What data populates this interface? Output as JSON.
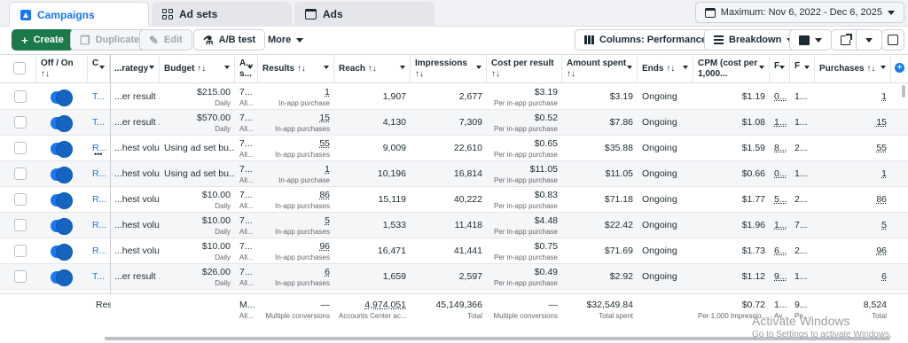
{
  "tabs": [
    {
      "label": "Campaigns",
      "icon": "campaign-icon"
    },
    {
      "label": "Ad sets",
      "icon": "grid-icon"
    },
    {
      "label": "Ads",
      "icon": "window-icon"
    }
  ],
  "date_range": "Maximum: Nov 6, 2022 - Dec 6, 2025",
  "toolbar": {
    "create": "Create",
    "duplicate": "Duplicate",
    "edit": "Edit",
    "ab_test": "A/B test",
    "more": "More",
    "columns": "Columns: Performance",
    "breakdown": "Breakdown"
  },
  "headers": {
    "off_on": "Off / On",
    "off_on_sort": "↑↓",
    "name": "C",
    "strategy": "...rategy",
    "budget": "Budget ↑↓",
    "attribution": "A...",
    "attribution2": "s...",
    "results": "Results ↑↓",
    "reach": "Reach ↑↓",
    "impressions": "Impressions",
    "impressions_sort": "↑↓",
    "cpr": "Cost per result",
    "cpr_sort": "↑↓",
    "amount_spent": "Amount spent",
    "amount_spent_sort": "↑↓",
    "ends": "Ends ↑↓",
    "cpm": "CPM (cost per",
    "cpm2": "1,000...",
    "col_f": "F",
    "col_i": "F",
    "purchases": "Purchases ↑↓"
  },
  "rows": [
    {
      "name": "T...",
      "strategy": "...er result ...",
      "budget": "$215.00",
      "budget_sub": "Daily",
      "attr": "7...",
      "attr_sub": "All...",
      "results": "1",
      "results_sub": "In-app purchase",
      "reach": "1,907",
      "impressions": "2,677",
      "cpr": "$3.19",
      "cpr_sub": "Per in-app purchase",
      "spent": "$3.19",
      "ends": "Ongoing",
      "cpm": "$1.19",
      "f": "0...",
      "i": "1...",
      "purchases": "1",
      "dots": false
    },
    {
      "name": "T...",
      "strategy": "...er result ...",
      "budget": "$570.00",
      "budget_sub": "Daily",
      "attr": "7...",
      "attr_sub": "All...",
      "results": "15",
      "results_sub": "In-app purchases",
      "reach": "4,130",
      "impressions": "7,309",
      "cpr": "$0.52",
      "cpr_sub": "Per in-app purchase",
      "spent": "$7.86",
      "ends": "Ongoing",
      "cpm": "$1.08",
      "f": "1...",
      "i": "1...",
      "purchases": "15",
      "dots": false
    },
    {
      "name": "R...",
      "strategy": "...hest volume",
      "budget": "Using ad set bu...",
      "budget_sub": "",
      "attr": "7...",
      "attr_sub": "All...",
      "results": "55",
      "results_sub": "In-app purchases",
      "reach": "9,009",
      "impressions": "22,610",
      "cpr": "$0.65",
      "cpr_sub": "Per in-app purchase",
      "spent": "$35.88",
      "ends": "Ongoing",
      "cpm": "$1.59",
      "f": "8...",
      "i": "2...",
      "purchases": "55",
      "dots": true
    },
    {
      "name": "R...",
      "strategy": "...hest volume",
      "budget": "Using ad set bu...",
      "budget_sub": "",
      "attr": "7...",
      "attr_sub": "All...",
      "results": "1",
      "results_sub": "In-app purchase",
      "reach": "10,196",
      "impressions": "16,814",
      "cpr": "$11.05",
      "cpr_sub": "Per in-app purchase",
      "spent": "$11.05",
      "ends": "Ongoing",
      "cpm": "$0.66",
      "f": "0...",
      "i": "1...",
      "purchases": "1",
      "dots": false
    },
    {
      "name": "R...",
      "strategy": "...hest volume",
      "budget": "$10.00",
      "budget_sub": "Daily",
      "attr": "7...",
      "attr_sub": "All...",
      "results": "86",
      "results_sub": "In-app purchases",
      "reach": "15,119",
      "impressions": "40,222",
      "cpr": "$0.83",
      "cpr_sub": "Per in-app purchase",
      "spent": "$71.18",
      "ends": "Ongoing",
      "cpm": "$1.77",
      "f": "5...",
      "i": "2...",
      "purchases": "86",
      "dots": false
    },
    {
      "name": "R...",
      "strategy": "...hest volume",
      "budget": "$10.00",
      "budget_sub": "Daily",
      "attr": "7...",
      "attr_sub": "All...",
      "results": "5",
      "results_sub": "In-app purchases",
      "reach": "1,533",
      "impressions": "11,418",
      "cpr": "$4.48",
      "cpr_sub": "Per in-app purchase",
      "spent": "$22.42",
      "ends": "Ongoing",
      "cpm": "$1.96",
      "f": "1...",
      "i": "7...",
      "purchases": "5",
      "dots": false
    },
    {
      "name": "R...",
      "strategy": "...hest volume",
      "budget": "$10.00",
      "budget_sub": "Daily",
      "attr": "7...",
      "attr_sub": "All...",
      "results": "96",
      "results_sub": "In-app purchases",
      "reach": "16,471",
      "impressions": "41,441",
      "cpr": "$0.75",
      "cpr_sub": "Per in-app purchase",
      "spent": "$71.69",
      "ends": "Ongoing",
      "cpm": "$1.73",
      "f": "6...",
      "i": "2...",
      "purchases": "96",
      "dots": false
    },
    {
      "name": "T...",
      "strategy": "...er result ...",
      "budget": "$26.00",
      "budget_sub": "Daily",
      "attr": "7...",
      "attr_sub": "All...",
      "results": "6",
      "results_sub": "In-app purchases",
      "reach": "1,659",
      "impressions": "2,597",
      "cpr": "$0.49",
      "cpr_sub": "Per in-app purchase",
      "spent": "$2.92",
      "ends": "Ongoing",
      "cpm": "$1.12",
      "f": "9...",
      "i": "1...",
      "purchases": "6",
      "dots": false
    }
  ],
  "footer": {
    "label": "Res",
    "attr": "M...",
    "attr_sub": "All...",
    "results": "—",
    "results_sub": "Multiple conversions",
    "reach": "4,974,051",
    "reach_sub": "Accounts Center ac...",
    "impressions": "45,149,366",
    "impressions_sub": "Total",
    "cpr": "—",
    "cpr_sub": "Multiple conversions",
    "spent": "$32,549.84",
    "spent_sub": "Total spent",
    "cpm": "$0.72",
    "cpm_sub": "Per 1,000 Impressio...",
    "f": "1...",
    "f_sub": "Av...",
    "i": "9...",
    "i_sub": "Pe...",
    "purchases": "8,524",
    "purchases_sub": "Total"
  },
  "watermark": {
    "title": "Activate Windows",
    "subtitle": "Go to Settings to activate Windows."
  },
  "colors": {
    "accent": "#1877f2",
    "create": "#1b7a4a"
  }
}
